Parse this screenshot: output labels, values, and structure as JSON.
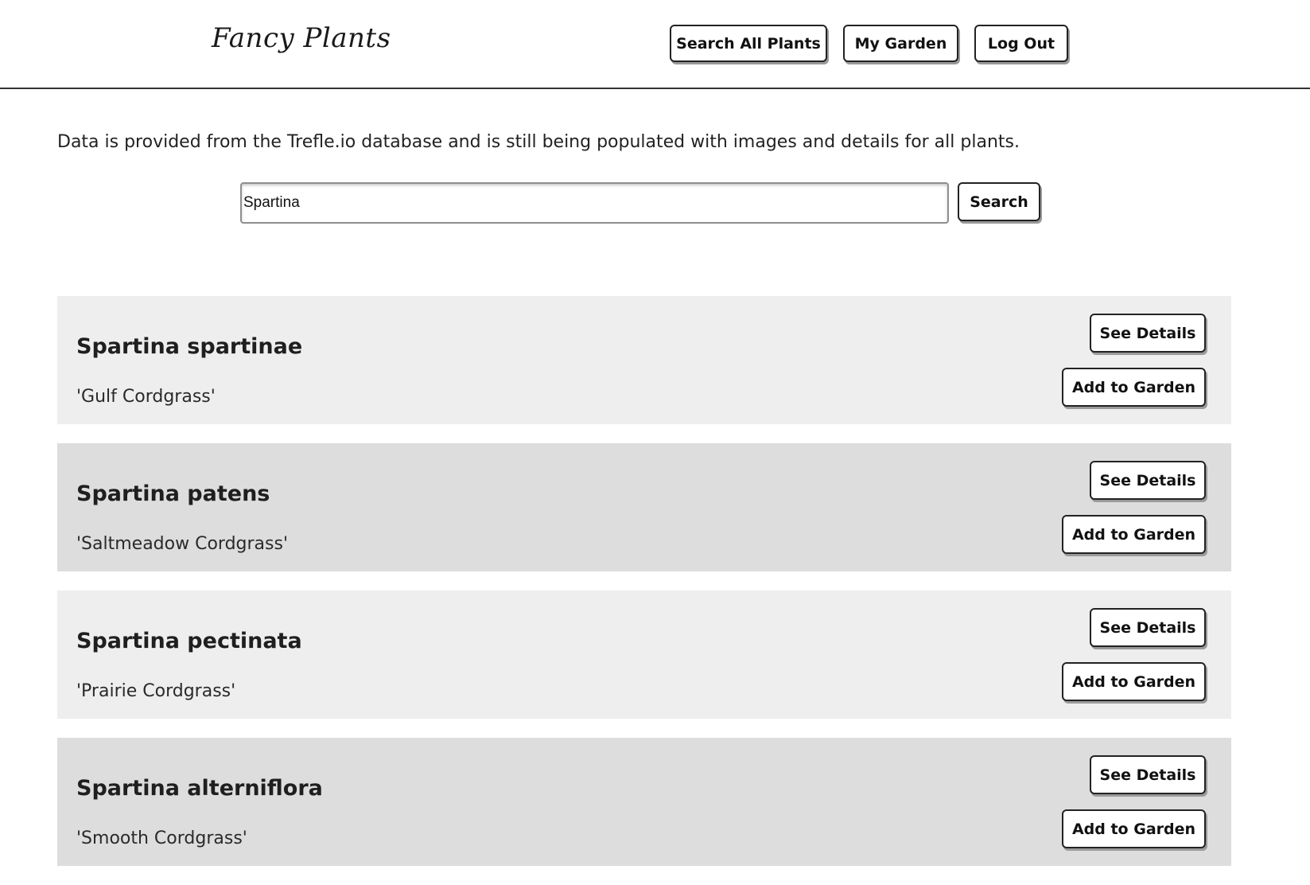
{
  "header": {
    "logo": "Fancy Plants",
    "nav": {
      "search_all_label": "Search All Plants",
      "my_garden_label": "My Garden",
      "logout_label": "Log Out"
    }
  },
  "notice": "Data is provided from the Trefle.io database and is still being populated with images and details for all plants.",
  "search": {
    "value": "Spartina",
    "button_label": "Search"
  },
  "results": [
    {
      "scientific_name": "Spartina spartinae",
      "common_name": "'Gulf Cordgrass'",
      "details_label": "See Details",
      "add_label": "Add to Garden"
    },
    {
      "scientific_name": "Spartina patens",
      "common_name": "'Saltmeadow Cordgrass'",
      "details_label": "See Details",
      "add_label": "Add to Garden"
    },
    {
      "scientific_name": "Spartina pectinata",
      "common_name": "'Prairie Cordgrass'",
      "details_label": "See Details",
      "add_label": "Add to Garden"
    },
    {
      "scientific_name": "Spartina alterniflora",
      "common_name": "'Smooth Cordgrass'",
      "details_label": "See Details",
      "add_label": "Add to Garden"
    }
  ],
  "colors": {
    "card_light": "#eeeeee",
    "card_dark": "#dddddd",
    "button_border": "#222222"
  }
}
